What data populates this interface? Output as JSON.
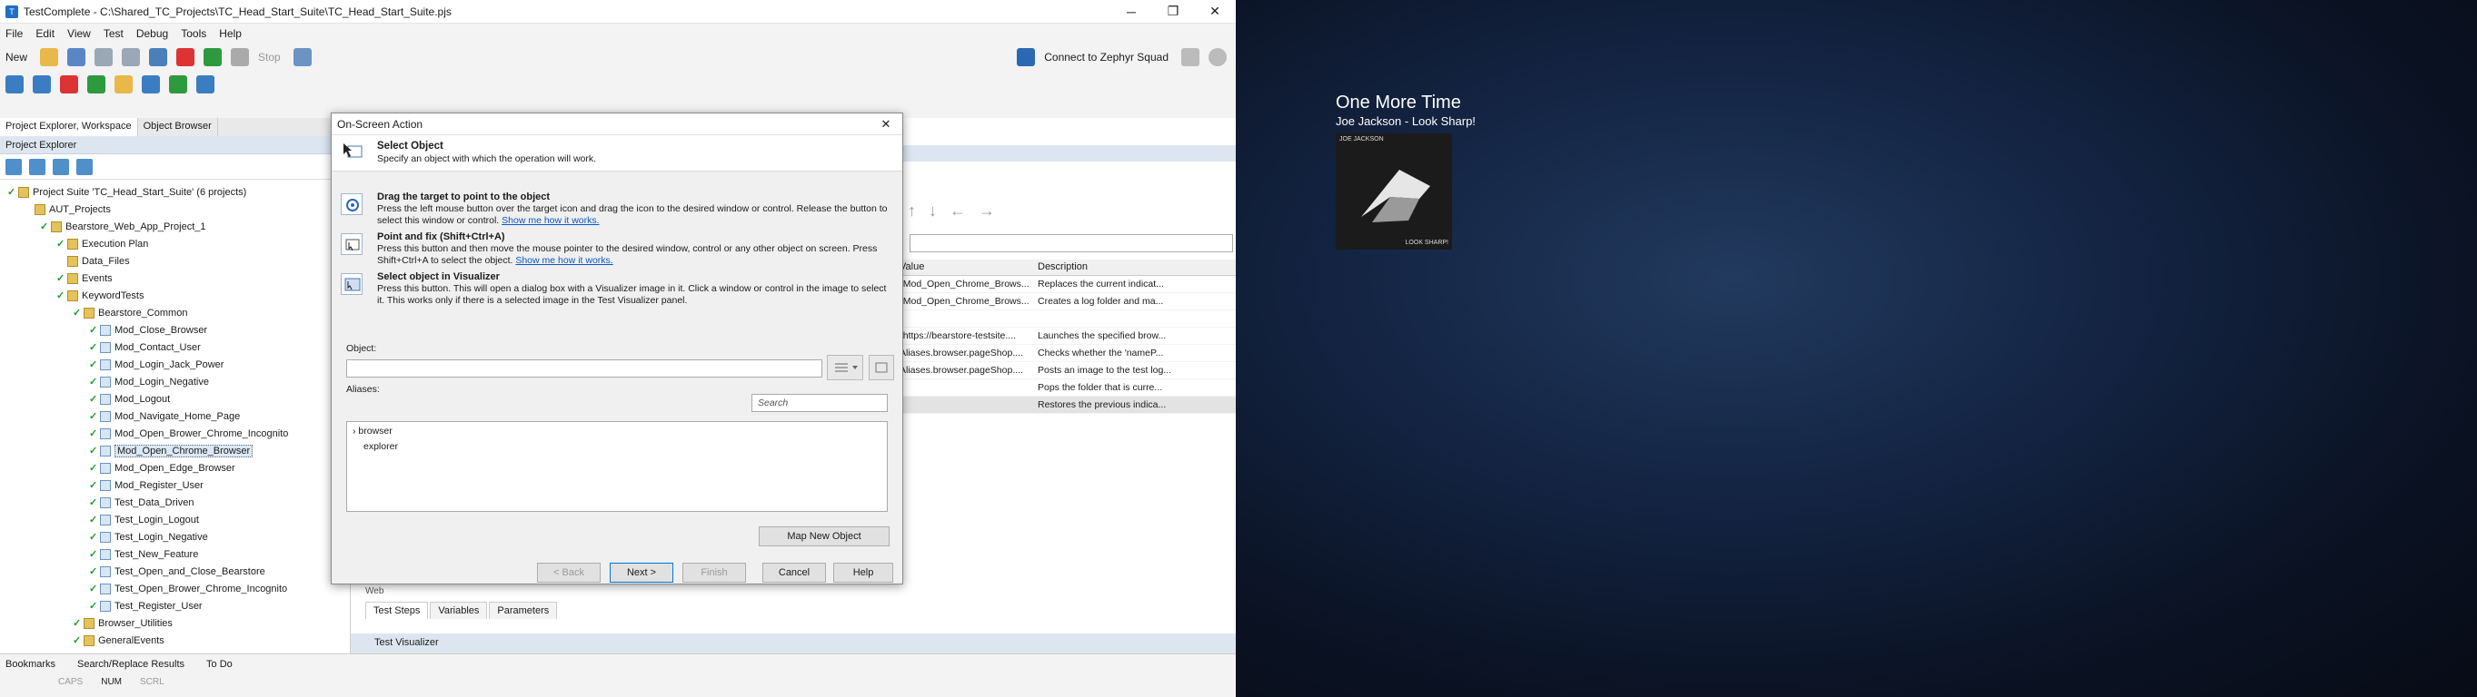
{
  "window": {
    "title": "TestComplete - C:\\Shared_TC_Projects\\TC_Head_Start_Suite\\TC_Head_Start_Suite.pjs"
  },
  "menu": [
    "File",
    "Edit",
    "View",
    "Test",
    "Debug",
    "Tools",
    "Help"
  ],
  "toolbar": {
    "new_label": "New",
    "stop_label": "Stop",
    "zephyr_label": "Connect to Zephyr Squad"
  },
  "left_tabs": [
    "Project Explorer, Workspace",
    "Object Browser"
  ],
  "panel_title": "Project Explorer",
  "tree": [
    {
      "label": "Project Suite 'TC_Head_Start_Suite' (6 projects)",
      "indent": 0
    },
    {
      "label": "AUT_Projects",
      "indent": 1
    },
    {
      "label": "Bearstore_Web_App_Project_1",
      "indent": 2
    },
    {
      "label": "Execution Plan",
      "indent": 3
    },
    {
      "label": "Data_Files",
      "indent": 3
    },
    {
      "label": "Events",
      "indent": 3
    },
    {
      "label": "KeywordTests",
      "indent": 3
    },
    {
      "label": "Bearstore_Common",
      "indent": 4
    },
    {
      "label": "Mod_Close_Browser",
      "indent": 5
    },
    {
      "label": "Mod_Contact_User",
      "indent": 5
    },
    {
      "label": "Mod_Login_Jack_Power",
      "indent": 5
    },
    {
      "label": "Mod_Login_Negative",
      "indent": 5
    },
    {
      "label": "Mod_Logout",
      "indent": 5
    },
    {
      "label": "Mod_Navigate_Home_Page",
      "indent": 5
    },
    {
      "label": "Mod_Open_Brower_Chrome_Incognito",
      "indent": 5
    },
    {
      "label": "Mod_Open_Chrome_Browser",
      "indent": 5
    },
    {
      "label": "Mod_Open_Edge_Browser",
      "indent": 5
    },
    {
      "label": "Mod_Register_User",
      "indent": 5
    },
    {
      "label": "Test_Data_Driven",
      "indent": 5
    },
    {
      "label": "Test_Login_Logout",
      "indent": 5
    },
    {
      "label": "Test_Login_Negative",
      "indent": 5
    },
    {
      "label": "Test_New_Feature",
      "indent": 5
    },
    {
      "label": "Test_Open_and_Close_Bearstore",
      "indent": 5
    },
    {
      "label": "Test_Open_Brower_Chrome_Incognito",
      "indent": 5
    },
    {
      "label": "Test_Register_User",
      "indent": 5
    },
    {
      "label": "Browser_Utilities",
      "indent": 4
    },
    {
      "label": "GeneralEvents",
      "indent": 4
    }
  ],
  "grid": {
    "headers": [
      "Value",
      "Description"
    ],
    "rows": [
      [
        "\"Mod_Open_Chrome_Brows...",
        "Replaces the current indicat..."
      ],
      [
        "\"Mod_Open_Chrome_Brows...",
        "Creates a log folder and ma..."
      ],
      [
        "",
        ""
      ],
      [
        "\"https://bearstore-testsite....",
        "Launches the specified brow..."
      ],
      [
        "Aliases.browser.pageShop....",
        "Checks whether the 'nameP..."
      ],
      [
        "Aliases.browser.pageShop....",
        "Posts an image to the test log..."
      ],
      [
        "",
        "Pops the folder that is curre..."
      ],
      [
        "",
        "Restores the previous indica..."
      ]
    ]
  },
  "bottom_tabs": [
    "Test Steps",
    "Variables",
    "Parameters"
  ],
  "web_label": "Web",
  "test_visualizer": "Test Visualizer",
  "status_tabs": [
    "Bookmarks",
    "Search/Replace Results",
    "To Do"
  ],
  "status_keys": [
    "CAPS",
    "NUM",
    "SCRL"
  ],
  "dialog": {
    "title": "On-Screen Action",
    "heading": "Select Object",
    "subheading": "Specify an object with which the operation will work.",
    "option1_title": "Drag the target to point to the object",
    "option1_desc": "Press the left mouse button over the target icon and drag the icon to the desired window or control. Release the button to select this window or control.",
    "option1_link": "Show me how it works.",
    "option2_title": "Point and fix (Shift+Ctrl+A)",
    "option2_desc": "Press this button and then move the mouse pointer to the desired window, control or any other object on screen. Press Shift+Ctrl+A to select the object.",
    "option2_link": "Show me how it works.",
    "option3_title": "Select object in Visualizer",
    "option3_desc": "Press this button. This will open a dialog box with a Visualizer image in it. Click a window or control in the image to select it. This works only if there is a selected image in the Test Visualizer panel.",
    "object_label": "Object:",
    "object_value": "",
    "aliases_label": "Aliases:",
    "search_placeholder": "Search",
    "aliases": [
      "browser",
      "explorer"
    ],
    "map_button": "Map New Object",
    "back_button": "< Back",
    "next_button": "Next >",
    "finish_button": "Finish",
    "cancel_button": "Cancel",
    "help_button": "Help"
  },
  "media": {
    "title": "One More Time",
    "artist": "Joe Jackson - Look Sharp!",
    "cover_title": "JOE JACKSON",
    "cover_sub": "LOOK SHARP!"
  },
  "colors": {
    "accent": "#0078d7",
    "check": "#1f9a2f",
    "panel_header": "#dde6f0"
  }
}
